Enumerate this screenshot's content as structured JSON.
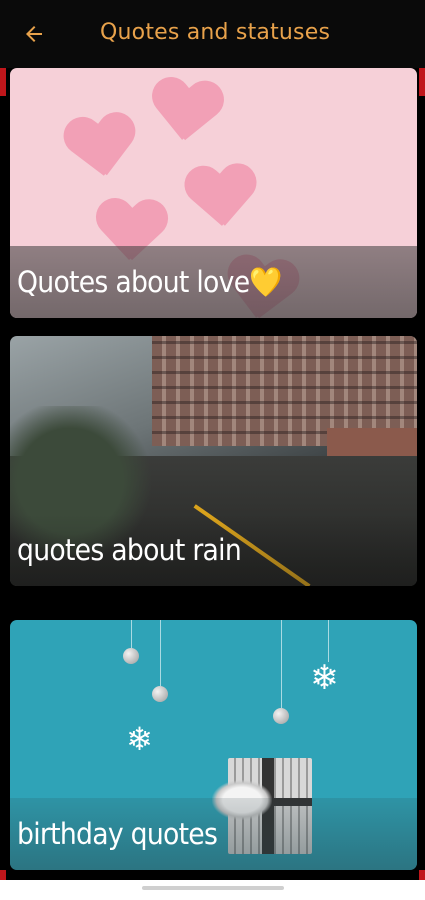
{
  "app_bar": {
    "title": "Quotes and statuses",
    "back_icon": "arrow-back-icon",
    "title_color": "#e8a24b"
  },
  "cards": [
    {
      "label": "Quotes about love💛",
      "image": "pink-felt-hearts"
    },
    {
      "label": "quotes about rain",
      "image": "rainy-city-street"
    },
    {
      "label": "birthday quotes",
      "image": "teal-ornaments-gift"
    }
  ],
  "colors": {
    "accent": "#e8a24b",
    "edge": "#c0161b",
    "background": "#000000"
  }
}
